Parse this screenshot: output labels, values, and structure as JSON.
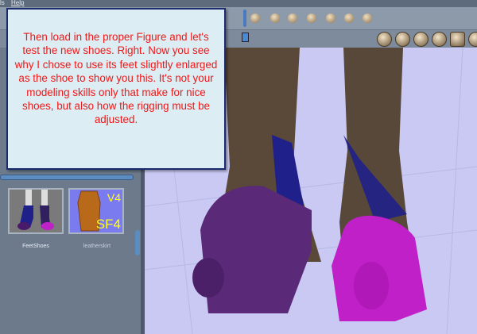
{
  "menu": {
    "items": [
      "ls",
      "Help"
    ]
  },
  "callout": {
    "text": "Then load in the proper Figure and let's test the new shoes. Right. Now you see why I chose to use its feet slightly enlarged as the shoe to show you this. It's not your modeling skills only that make for nice shoes, but also how the rigging must be adjusted."
  },
  "library": {
    "items": [
      {
        "label": "FeetShoes"
      },
      {
        "label": "leatherskirt",
        "badge_top": "V4",
        "badge_bottom": "SF4"
      }
    ]
  },
  "colors": {
    "callout_text": "#f01818",
    "callout_bg": "#dcedf3",
    "floor": "#c9c9f4",
    "toe_left": "#5a2a78",
    "toe_right": "#c020c8"
  }
}
